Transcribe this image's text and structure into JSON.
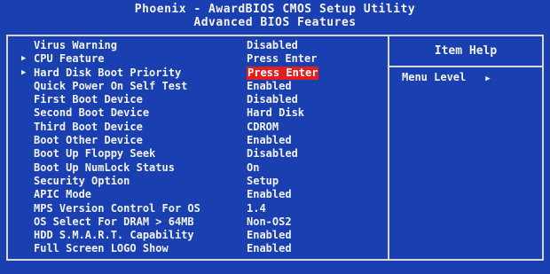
{
  "header": {
    "title": "Phoenix - AwardBIOS CMOS Setup Utility",
    "subtitle": "Advanced BIOS Features"
  },
  "settings": [
    {
      "label": "Virus Warning",
      "value": "Disabled",
      "submenu": false
    },
    {
      "label": "CPU Feature",
      "value": "Press Enter",
      "submenu": true
    },
    {
      "label": "Hard Disk Boot Priority",
      "value": "Press Enter",
      "submenu": true,
      "selected": true
    },
    {
      "label": "Quick Power On Self Test",
      "value": "Enabled",
      "submenu": false
    },
    {
      "label": "First Boot Device",
      "value": "Disabled",
      "submenu": false
    },
    {
      "label": "Second Boot Device",
      "value": "Hard Disk",
      "submenu": false
    },
    {
      "label": "Third Boot Device",
      "value": "CDROM",
      "submenu": false
    },
    {
      "label": "Boot Other Device",
      "value": "Enabled",
      "submenu": false
    },
    {
      "label": "Boot Up Floppy Seek",
      "value": "Disabled",
      "submenu": false
    },
    {
      "label": "Boot Up NumLock Status",
      "value": "On",
      "submenu": false
    },
    {
      "label": "Security Option",
      "value": "Setup",
      "submenu": false
    },
    {
      "label": "APIC Mode",
      "value": "Enabled",
      "submenu": false
    },
    {
      "label": "MPS Version Control For OS",
      "value": "1.4",
      "submenu": false
    },
    {
      "label": "OS Select For DRAM > 64MB",
      "value": "Non-OS2",
      "submenu": false
    },
    {
      "label": "HDD S.M.A.R.T. Capability",
      "value": "Enabled",
      "submenu": false
    },
    {
      "label": "Full Screen LOGO Show",
      "value": "Enabled",
      "submenu": false
    }
  ],
  "help_panel": {
    "title": "Item Help",
    "menu_level_label": "Menu Level",
    "menu_level_icon": "right-triangle-icon"
  },
  "colors": {
    "background": "#1a3fb0",
    "selected_highlight": "#e01f1f",
    "text": "#f2f2f2"
  }
}
